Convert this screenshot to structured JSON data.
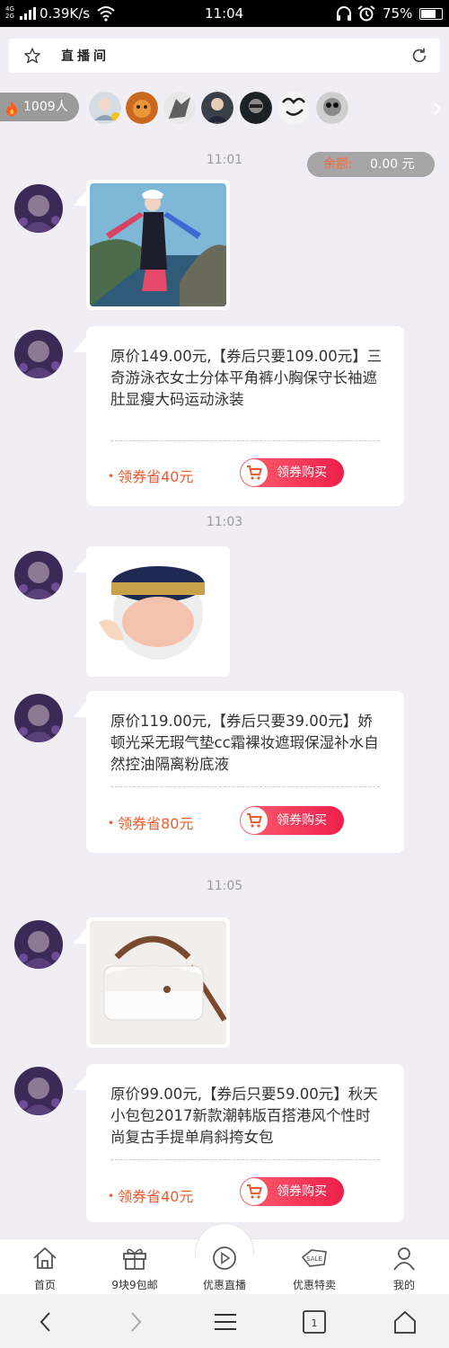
{
  "status_bar": {
    "network": "4G\n2G",
    "speed": "0.39K/s",
    "time": "11:04",
    "battery": "75%",
    "battery_level": 0.75
  },
  "header": {
    "title": "直播间",
    "star_icon": "star-outline-icon",
    "refresh_icon": "refresh-icon"
  },
  "viewers": {
    "count": "1009人",
    "avatar_count": 8
  },
  "balance": {
    "label": "余额:",
    "value": "0.00 元"
  },
  "timestamps": [
    "11:01",
    "11:03",
    "11:05"
  ],
  "products": [
    {
      "image": "woman-swimsuit-photo",
      "desc": "原价149.00元,【券后只要109.00元】三奇游泳衣女士分体平角裤小胸保守长袖遮肚显瘦大码运动泳装",
      "save": "领券省40元",
      "buy": "领券购买"
    },
    {
      "image": "cushion-foundation-photo",
      "desc": "原价119.00元,【券后只要39.00元】娇顿光采无瑕气垫cc霜裸妆遮瑕保湿补水自然控油隔离粉底液",
      "save": "领券省80元",
      "buy": "领券购买"
    },
    {
      "image": "white-handbag-photo",
      "desc": "原价99.00元,【券后只要59.00元】秋天小包包2017新款潮韩版百搭港风个性时尚复古手提单肩斜挎女包",
      "save": "领券省40元",
      "buy": "领券购买"
    }
  ],
  "tabs": [
    {
      "label": "首页",
      "icon": "home-icon"
    },
    {
      "label": "9块9包邮",
      "icon": "gift-icon"
    },
    {
      "label": "优惠直播",
      "icon": "play-icon"
    },
    {
      "label": "优惠特卖",
      "icon": "sale-tag-icon"
    },
    {
      "label": "我的",
      "icon": "person-icon"
    }
  ],
  "nav": [
    "back-icon",
    "forward-icon",
    "menu-icon",
    "tabs-icon",
    "home-outline-icon"
  ],
  "colors": {
    "accent": "#f25a2a",
    "buy_button": "#ef1f4a",
    "page_bg": "#f0eef4"
  }
}
